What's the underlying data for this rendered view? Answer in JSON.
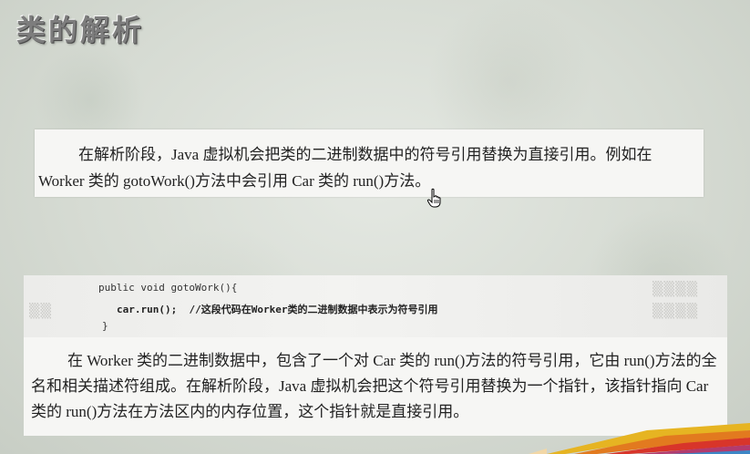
{
  "slide": {
    "title": "类的解析"
  },
  "box1": {
    "paragraph": "在解析阶段，Java 虚拟机会把类的二进制数据中的符号引用替换为直接引用。例如在 Worker 类的 gotoWork()方法中会引用 Car 类的 run()方法。"
  },
  "box2": {
    "code_line1": "public void gotoWork(){",
    "code_line2_code": "car.run();",
    "code_line2_comment": "//这段代码在Worker类的二进制数据中表示为符号引用",
    "code_line3": "}",
    "paragraph": "在 Worker 类的二进制数据中，包含了一个对 Car 类的 run()方法的符号引用，它由 run()方法的全名和相关描述符组成。在解析阶段，Java 虚拟机会把这个符号引用替换为一个指针，该指针指向 Car 类的 run()方法在方法区内的内存位置，这个指针就是直接引用。"
  },
  "icons": {
    "cursor": "hand-pointer-icon",
    "decoration": "colored-pencils"
  },
  "colors": {
    "title": "#7d7d7d",
    "background": "#d6dbd3",
    "box": "#f6f6f4"
  }
}
